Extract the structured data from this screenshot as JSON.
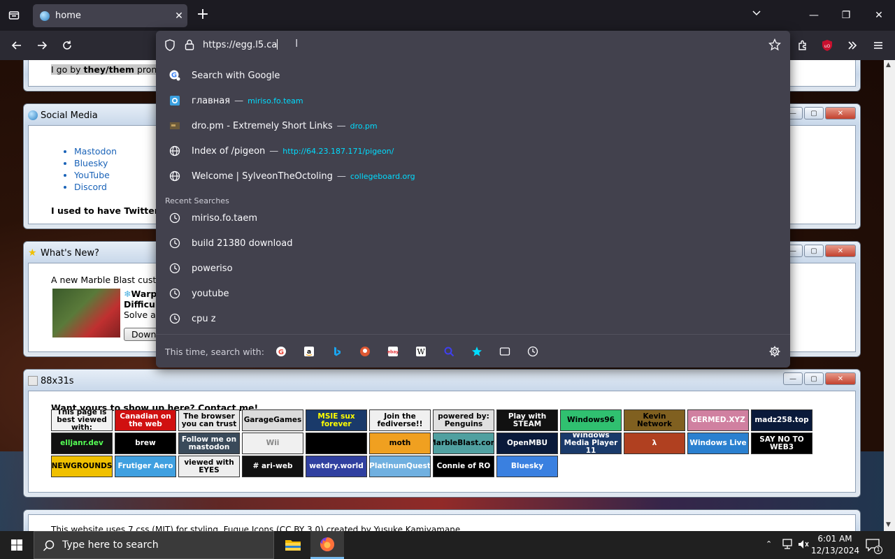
{
  "browser": {
    "tab_title": "home",
    "url_value": "https://egg.l5.ca"
  },
  "page": {
    "pronoun_intro": "I go by",
    "pronoun_bold": "they/them",
    "pronoun_rest": "pronou",
    "social": {
      "title": "Social Media",
      "links": [
        "Mastodon",
        "Bluesky",
        "YouTube",
        "Discord"
      ],
      "note_bold": "I used to have Twitter, bu"
    },
    "whats_new": {
      "title": "What's New?",
      "line1": "A new Marble Blast custor",
      "item_title": "Warp",
      "item_sub": "Difficult",
      "item_desc": "Solve all",
      "download": "Downl"
    },
    "buttons88": {
      "title": "88x31s",
      "heading": "Want yours to show up here? Contact me!",
      "badges": [
        {
          "t": "This page is best viewed with:",
          "bg": "#f2f2f2",
          "fg": "#000"
        },
        {
          "t": "Canadian on the web",
          "bg": "#d01010",
          "fg": "#fff"
        },
        {
          "t": "The browser you can trust",
          "bg": "#e8e8e8",
          "fg": "#000"
        },
        {
          "t": "GarageGames",
          "bg": "#dcdcdc",
          "fg": "#000"
        },
        {
          "t": "MSIE sux forever",
          "bg": "#1a3a6a",
          "fg": "#ff0"
        },
        {
          "t": "Join the fediverse!!",
          "bg": "#f0f0f0",
          "fg": "#000"
        },
        {
          "t": "powered by: Penguins",
          "bg": "#e0e0e0",
          "fg": "#000"
        },
        {
          "t": "Play with STEAM",
          "bg": "#111",
          "fg": "#fff"
        },
        {
          "t": "Windows96",
          "bg": "#30c070",
          "fg": "#000"
        },
        {
          "t": "Kevin Network",
          "bg": "#806020",
          "fg": "#000"
        },
        {
          "t": "GERMED.XYZ",
          "bg": "#d080a0",
          "fg": "#fff"
        },
        {
          "t": "madz258.top",
          "bg": "#0a1a3a",
          "fg": "#fff"
        },
        {
          "t": "elljanr.dev",
          "bg": "#111",
          "fg": "#5f5"
        },
        {
          "t": "brew",
          "bg": "#000",
          "fg": "#fff"
        },
        {
          "t": "Follow me on mastodon",
          "bg": "#3a4a5a",
          "fg": "#fff"
        },
        {
          "t": "Wii",
          "bg": "#f0f0f0",
          "fg": "#888"
        },
        {
          "t": "",
          "bg": "#000",
          "fg": "#fff"
        },
        {
          "t": "moth",
          "bg": "#f0a020",
          "fg": "#000"
        },
        {
          "t": "MarbleBlast.com",
          "bg": "#50a0a0",
          "fg": "#000"
        },
        {
          "t": "OpenMBU",
          "bg": "#0a1a3a",
          "fg": "#fff"
        },
        {
          "t": "Windows Media Player 11",
          "bg": "#1a3a6a",
          "fg": "#fff"
        },
        {
          "t": "λ",
          "bg": "#b04020",
          "fg": "#fff"
        },
        {
          "t": "Windows Live",
          "bg": "#2a80d0",
          "fg": "#fff"
        },
        {
          "t": "SAY NO TO WEB3",
          "bg": "#000",
          "fg": "#fff"
        },
        {
          "t": "NEWGROUNDS",
          "bg": "#f0c000",
          "fg": "#000"
        },
        {
          "t": "Frutiger Aero",
          "bg": "#40a0e0",
          "fg": "#fff"
        },
        {
          "t": "viewed with EYES",
          "bg": "#eee",
          "fg": "#000"
        },
        {
          "t": "# ari-web",
          "bg": "#111",
          "fg": "#fff"
        },
        {
          "t": "wetdry.world",
          "bg": "#3040a0",
          "fg": "#fff"
        },
        {
          "t": "PlatinumQuest",
          "bg": "#70b0e0",
          "fg": "#fff"
        },
        {
          "t": "Connie of RO",
          "bg": "#000",
          "fg": "#fff"
        },
        {
          "t": "Bluesky",
          "bg": "#3a80e0",
          "fg": "#fff"
        }
      ]
    },
    "footer_text": "This website uses 7.css (MIT) for styling. Fugue Icons (CC BY 3.0) created by Yusuke Kamiyamane"
  },
  "dropdown": {
    "search_with": "Search with Google",
    "suggestions": [
      {
        "title": "главная",
        "url": "miriso.fo.team"
      },
      {
        "title": "dro.pm - Extremely Short Links",
        "url": "dro.pm"
      },
      {
        "title": "Index of /pigeon",
        "url": "http://64.23.187.171/pigeon/"
      },
      {
        "title": "Welcome | SylveonTheOctoling",
        "url": "collegeboard.org"
      }
    ],
    "separator": "—",
    "recent_header": "Recent Searches",
    "recent": [
      "miriso.fo.taem",
      "build 21380 download",
      "poweriso",
      "youtube",
      "cpu z"
    ],
    "footer_label": "This time, search with:"
  },
  "taskbar": {
    "search_placeholder": "Type here to search",
    "time": "6:01 AM",
    "date": "12/13/2024",
    "notification_count": "1"
  }
}
